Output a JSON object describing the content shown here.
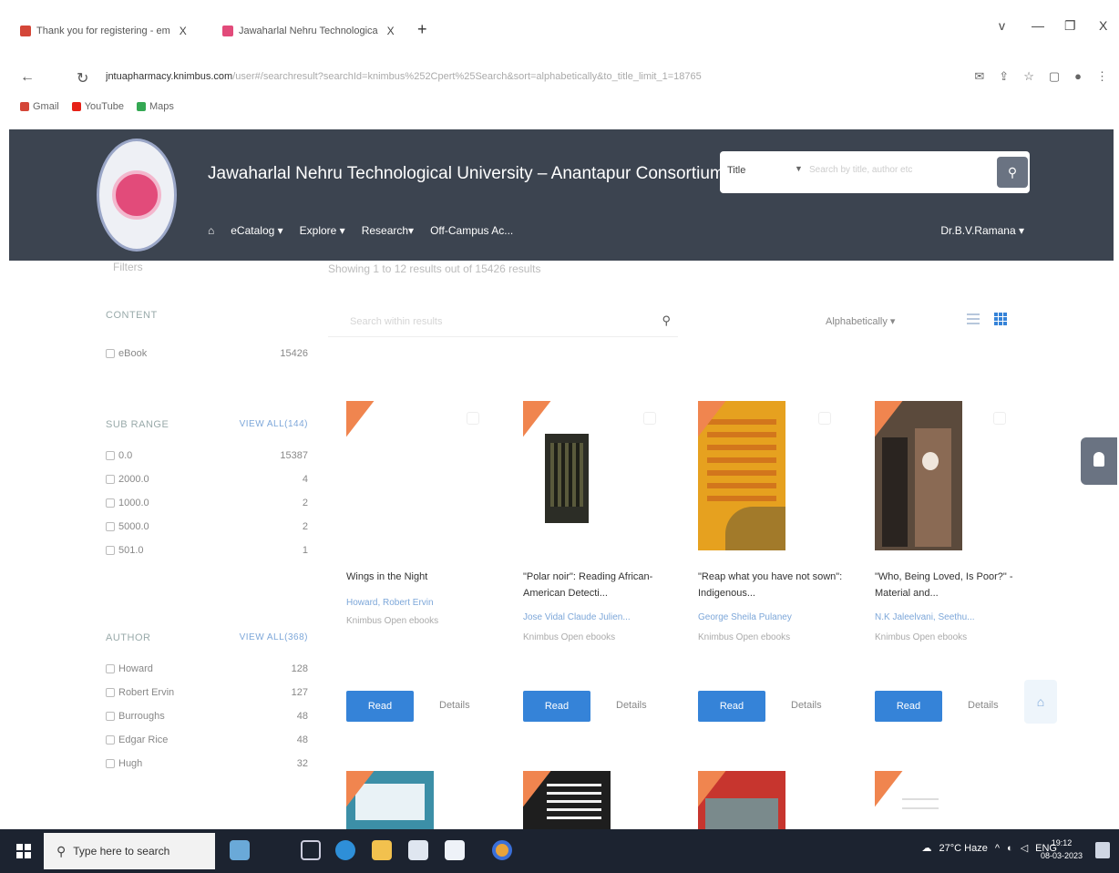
{
  "browser": {
    "tabs": [
      {
        "title": "Thank you for registering - em",
        "close": "X"
      },
      {
        "title": "Jawaharlal Nehru Technologica",
        "close": "X"
      }
    ],
    "new_tab": "+",
    "url_host": "jntuapharmacy.knimbus.com",
    "url_path": "/user#/searchresult?searchId=knimbus%252Cpert%25Search&sort=alphabetically&to_title_limit_1=18765",
    "bookmarks": [
      "Gmail",
      "YouTube",
      "Maps"
    ],
    "window_controls": [
      "v",
      "—",
      "❐",
      "X"
    ]
  },
  "site": {
    "title": "Jawaharlal Nehru Technological University – Anantapur Consortium ...",
    "search_field": "Title",
    "search_placeholder": "Search by title, author etc",
    "nav": [
      "eCatalog ▾",
      "Explore ▾",
      "Research▾",
      "Off-Campus Ac..."
    ],
    "user": "Dr.B.V.Ramana ▾"
  },
  "filters": {
    "header": "Filters",
    "result_strip": "Showing 1 to 12 results out of 15426 results"
  },
  "sidebar": {
    "content": {
      "title": "CONTENT",
      "items": [
        {
          "label": "eBook",
          "count": "15426"
        }
      ]
    },
    "subrange": {
      "title": "SUB RANGE",
      "more": "VIEW ALL(144)",
      "items": [
        {
          "label": "0.0",
          "count": "15387"
        },
        {
          "label": "2000.0",
          "count": "4"
        },
        {
          "label": "1000.0",
          "count": "2"
        },
        {
          "label": "5000.0",
          "count": "2"
        },
        {
          "label": "501.0",
          "count": "1"
        }
      ]
    },
    "author": {
      "title": "AUTHOR",
      "more": "VIEW ALL(368)",
      "items": [
        {
          "label": "Howard",
          "count": "128"
        },
        {
          "label": "Robert Ervin",
          "count": "127"
        },
        {
          "label": "Burroughs",
          "count": "48"
        },
        {
          "label": "Edgar Rice",
          "count": "48"
        },
        {
          "label": "Hugh",
          "count": "32"
        }
      ]
    }
  },
  "toolbar": {
    "search_placeholder": "Search within results",
    "sort": "Alphabetically ▾"
  },
  "books": [
    {
      "title": "Wings in the Night",
      "author": "Howard, Robert Ervin",
      "publisher": "Knimbus Open ebooks",
      "read": "Read",
      "details": "Details"
    },
    {
      "title": "\"Polar noir\": Reading African-American Detecti...",
      "author": "Jose Vidal Claude Julien...",
      "publisher": "Knimbus Open ebooks",
      "read": "Read",
      "details": "Details"
    },
    {
      "title": "\"Reap what you have not sown\": Indigenous...",
      "author": "George Sheila Pulaney",
      "publisher": "Knimbus Open ebooks",
      "read": "Read",
      "details": "Details"
    },
    {
      "title": "\"Who, Being Loved, Is Poor?\" - Material and...",
      "author": "N.K Jaleelvani, Seethu...",
      "publisher": "Knimbus Open ebooks",
      "read": "Read",
      "details": "Details"
    }
  ],
  "taskbar": {
    "search_placeholder": "Type here to search",
    "weather": "27°C Haze",
    "lang": "ENG",
    "time": "19:12",
    "date": "08-03-2023"
  },
  "colors": {
    "header_bg": "#3c4450",
    "accent": "#3583d8",
    "ribbon": "#f0854f"
  }
}
